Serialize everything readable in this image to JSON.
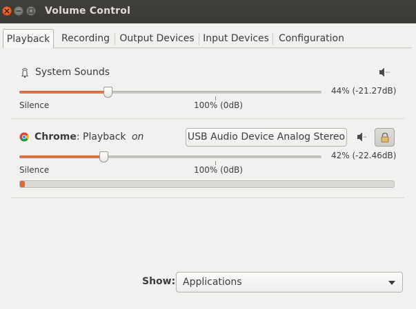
{
  "window": {
    "title": "Volume Control"
  },
  "tabs": [
    {
      "label": "Playback"
    },
    {
      "label": "Recording"
    },
    {
      "label": "Output Devices"
    },
    {
      "label": "Input Devices"
    },
    {
      "label": "Configuration"
    }
  ],
  "system_sounds": {
    "name": "System Sounds",
    "volume_label": "44% (-21.27dB)",
    "volume_fraction": 0.44,
    "silence_label": "Silence",
    "reference_label": "100% (0dB)"
  },
  "chrome": {
    "app_name": "Chrome",
    "stream_name": ": Playback",
    "state": "on",
    "device": "USB Audio Device Analog Stereo",
    "volume_label": "42% (-22.46dB)",
    "volume_fraction": 0.42,
    "silence_label": "Silence",
    "reference_label": "100% (0dB)",
    "peak_fraction": 0.02
  },
  "show": {
    "label": "Show:",
    "value": "Applications"
  },
  "colors": {
    "accent": "#e2764a",
    "titlebar": "#3c3b37",
    "close": "#dd4814"
  }
}
